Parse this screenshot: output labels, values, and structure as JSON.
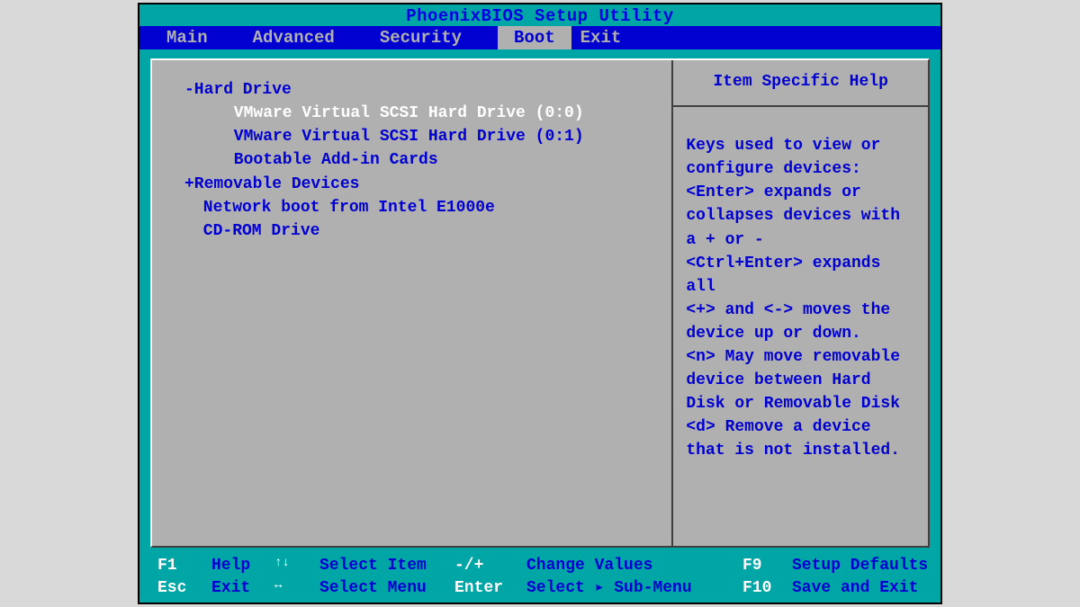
{
  "title": "PhoenixBIOS Setup Utility",
  "menu": {
    "items": [
      "Main",
      "Advanced",
      "Security",
      "Boot",
      "Exit"
    ],
    "active_index": 3
  },
  "boot": {
    "items": [
      {
        "prefix": "-",
        "label": "Hard Drive",
        "indent": 1,
        "selected": false
      },
      {
        "prefix": "",
        "label": "VMware Virtual SCSI Hard Drive (0:0)",
        "indent": 2,
        "selected": true
      },
      {
        "prefix": "",
        "label": "VMware Virtual SCSI Hard Drive (0:1)",
        "indent": 2,
        "selected": false
      },
      {
        "prefix": "",
        "label": "Bootable Add-in Cards",
        "indent": 2,
        "selected": false
      },
      {
        "prefix": "+",
        "label": "Removable Devices",
        "indent": 1,
        "selected": false
      },
      {
        "prefix": "",
        "label": "Network boot from Intel E1000e",
        "indent": "1b",
        "selected": false
      },
      {
        "prefix": "",
        "label": "CD-ROM Drive",
        "indent": "1b",
        "selected": false
      }
    ]
  },
  "help": {
    "title": "Item Specific Help",
    "body": "Keys used to view or configure devices:\n<Enter> expands or collapses devices with a + or -\n<Ctrl+Enter> expands all\n<+> and <-> moves the device up or down.\n<n> May move removable device between Hard Disk or Removable Disk\n<d> Remove a device that is not installed."
  },
  "footer": {
    "row1": {
      "k1": "F1",
      "d1": "Help",
      "k2": "↑↓",
      "d2": "Select Item",
      "k3": "-/+",
      "d3": "Change Values",
      "k4": "F9",
      "d4": "Setup Defaults"
    },
    "row2": {
      "k1": "Esc",
      "d1": "Exit",
      "k2": "↔",
      "d2": "Select Menu",
      "k3": "Enter",
      "d3": "Select ▸ Sub-Menu",
      "k4": "F10",
      "d4": "Save and Exit"
    }
  }
}
